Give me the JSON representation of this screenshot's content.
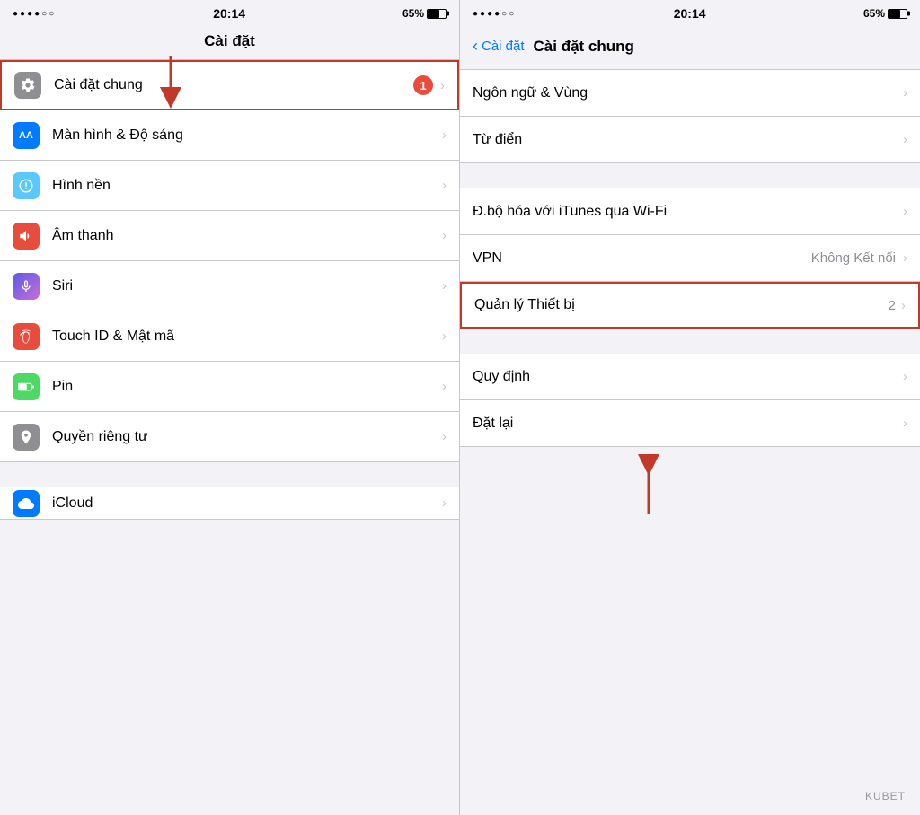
{
  "left": {
    "status": {
      "dots": "●●●●○○",
      "time": "20:14",
      "battery_pct": "65%"
    },
    "nav_title": "Cài đặt",
    "items": [
      {
        "id": "cai-dat-chung",
        "label": "Cài đặt chung",
        "icon_type": "gear",
        "icon_color": "gray",
        "badge": "1",
        "highlighted": true
      },
      {
        "id": "man-hinh",
        "label": "Màn hình & Độ sáng",
        "icon_type": "AA",
        "icon_color": "blue",
        "badge": null,
        "highlighted": false
      },
      {
        "id": "hinh-nen",
        "label": "Hình nền",
        "icon_type": "flower",
        "icon_color": "teal",
        "badge": null,
        "highlighted": false
      },
      {
        "id": "am-thanh",
        "label": "Âm thanh",
        "icon_type": "speaker",
        "icon_color": "red",
        "badge": null,
        "highlighted": false
      },
      {
        "id": "siri",
        "label": "Siri",
        "icon_type": "siri",
        "icon_color": "purple",
        "badge": null,
        "highlighted": false
      },
      {
        "id": "touch-id",
        "label": "Touch ID & Mật mã",
        "icon_type": "fingerprint",
        "icon_color": "pink-red",
        "badge": null,
        "highlighted": false
      },
      {
        "id": "pin",
        "label": "Pin",
        "icon_type": "battery",
        "icon_color": "green",
        "badge": null,
        "highlighted": false
      },
      {
        "id": "quyen-rieng-tu",
        "label": "Quyền riêng tư",
        "icon_type": "hand",
        "icon_color": "gray-dark",
        "badge": null,
        "highlighted": false
      },
      {
        "id": "icloud",
        "label": "iCloud",
        "icon_type": "cloud",
        "icon_color": "blue",
        "badge": null,
        "highlighted": false
      }
    ]
  },
  "right": {
    "status": {
      "dots": "●●●●○○",
      "time": "20:14",
      "battery_pct": "65%"
    },
    "back_label": "Cài đặt",
    "nav_title": "Cài đặt chung",
    "sections": [
      {
        "items": [
          {
            "id": "ngon-ngu",
            "label": "Ngôn ngữ & Vùng",
            "value": null,
            "badge": null
          },
          {
            "id": "tu-dien",
            "label": "Từ điển",
            "value": null,
            "badge": null
          }
        ]
      },
      {
        "items": [
          {
            "id": "dbohoa",
            "label": "Đ.bộ hóa với iTunes qua Wi-Fi",
            "value": null,
            "badge": null
          },
          {
            "id": "vpn",
            "label": "VPN",
            "value": "Không Kết nối",
            "badge": null
          },
          {
            "id": "quan-ly-thiet-bi",
            "label": "Quản lý Thiết bị",
            "value": null,
            "badge": "2",
            "highlighted": true
          }
        ]
      },
      {
        "items": [
          {
            "id": "quy-dinh",
            "label": "Quy định",
            "value": null,
            "badge": null
          },
          {
            "id": "dat-lai",
            "label": "Đặt lại",
            "value": null,
            "badge": null
          }
        ]
      }
    ],
    "kubet": "KUBET"
  }
}
